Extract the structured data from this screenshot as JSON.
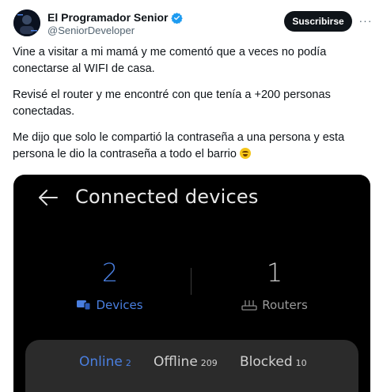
{
  "tweet": {
    "display_name": "El Programador Senior",
    "handle": "@SeniorDeveloper",
    "subscribe_label": "Suscribirse",
    "more_label": "···",
    "paragraphs": [
      "Vine a visitar a mi mamá y me comentó que a veces no podía conectarse al WIFI de casa.",
      "Revisé el router y me encontré con que tenía a +200 personas conectadas.",
      "Me dijo que solo le compartió la contraseña a una persona y esta persona le dio la contraseña a todo el barrio"
    ],
    "emoji_icon": "rolling-on-floor-laughing-icon"
  },
  "screenshot": {
    "title": "Connected devices",
    "stats": {
      "devices_count": "2",
      "devices_label": "Devices",
      "routers_count": "1",
      "routers_label": "Routers"
    },
    "tabs": [
      {
        "label": "Online",
        "count": "2"
      },
      {
        "label": "Offline",
        "count": "209"
      },
      {
        "label": "Blocked",
        "count": "10"
      }
    ]
  },
  "colors": {
    "accent_blue": "#4a7fe0",
    "verified_blue": "#1d9bf0",
    "media_bg": "#000000",
    "tab_bar_bg": "#2b2b2b"
  }
}
